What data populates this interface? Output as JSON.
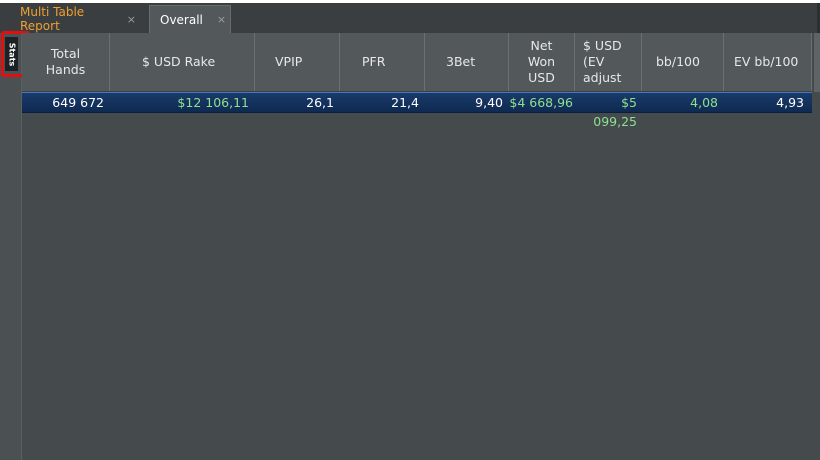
{
  "tabs": [
    {
      "label": "Multi Table Report",
      "close": "×",
      "active": false,
      "color": "#f0a030"
    },
    {
      "label": "Overall",
      "close": "×",
      "active": true
    }
  ],
  "sidebar": {
    "stats_label": "Stats",
    "highlight_color": "#e01010"
  },
  "table": {
    "columns": [
      "Total\nHands",
      "$ USD Rake",
      "VPIP",
      "PFR",
      "3Bet",
      "Net\nWon\nUSD",
      "$ USD\n(EV\nadjust",
      "bb/100",
      "EV bb/100"
    ],
    "row": [
      "649 672",
      "$12 106,11",
      "26,1",
      "21,4",
      "9,40",
      "$4 668,96",
      "$5 099,25",
      "4,08",
      "4,93"
    ]
  },
  "colors": {
    "positive_value": "#8ee08e",
    "selected_row": "#14335e",
    "background": "#454a4d"
  }
}
